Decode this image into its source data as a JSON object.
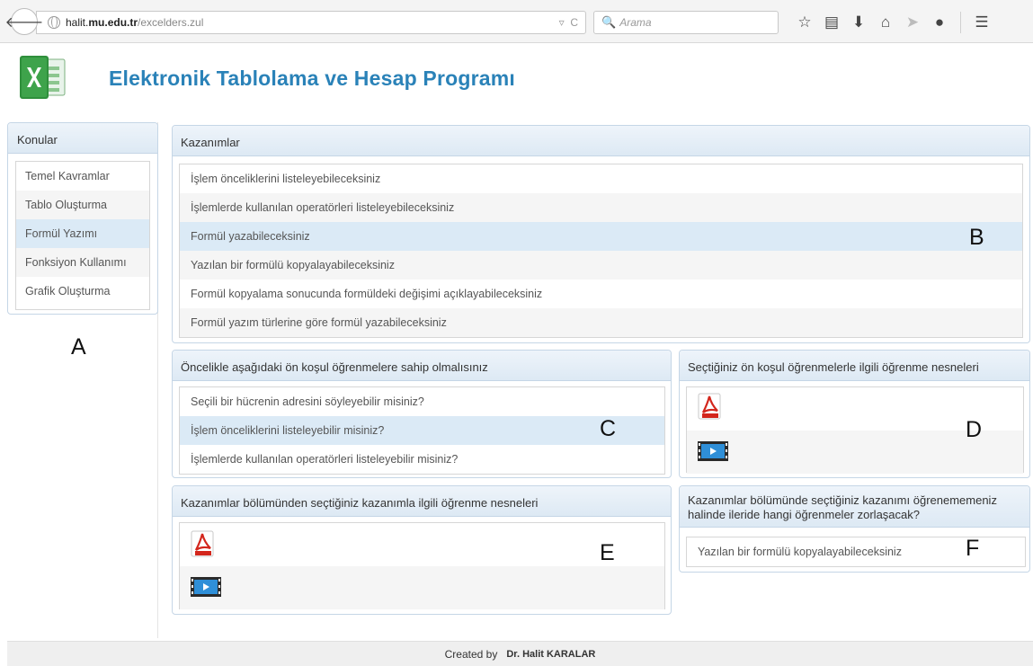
{
  "browser": {
    "url_host_prefix": "halit.",
    "url_host_domain": "mu.edu.tr",
    "url_path": "/excelders.zul",
    "search_placeholder": "Arama"
  },
  "page": {
    "title": "Elektronik Tablolama ve Hesap Programı"
  },
  "sidebar": {
    "header": "Konular",
    "items": [
      "Temel Kavramlar",
      "Tablo Oluşturma",
      "Formül Yazımı",
      "Fonksiyon Kullanımı",
      "Grafik Oluşturma"
    ],
    "selected_index": 2,
    "marker": "A"
  },
  "kazanimlar": {
    "header": "Kazanımlar",
    "items": [
      "İşlem önceliklerini listeleyebileceksiniz",
      "İşlemlerde kullanılan operatörleri listeleyebileceksiniz",
      "Formül yazabileceksiniz",
      "Yazılan bir formülü kopyalayabileceksiniz",
      "Formül kopyalama sonucunda formüldeki değişimi açıklayabileceksiniz",
      "Formül yazım türlerine göre formül yazabileceksiniz"
    ],
    "selected_index": 2,
    "marker": "B"
  },
  "prerequisites": {
    "header": "Öncelikle aşağıdaki ön koşul öğrenmelere sahip olmalısınız",
    "items": [
      "Seçili bir hücrenin adresini söyleyebilir misiniz?",
      "İşlem önceliklerini listeleyebilir misiniz?",
      "İşlemlerde kullanılan operatörleri listeleyebilir misiniz?"
    ],
    "selected_index": 1,
    "marker": "C"
  },
  "prereq_objects": {
    "header": "Seçtiğiniz ön koşul öğrenmelerle ilgili öğrenme nesneleri",
    "icons": [
      "pdf-icon",
      "video-icon"
    ],
    "marker": "D"
  },
  "learning_objects": {
    "header": "Kazanımlar bölümünden seçtiğiniz kazanımla ilgili öğrenme nesneleri",
    "icons": [
      "pdf-icon",
      "video-icon"
    ],
    "marker": "E"
  },
  "future_difficulty": {
    "header": "Kazanımlar bölümünde seçtiğiniz kazanımı öğrenememeniz halinde ileride hangi öğrenmeler zorlaşacak?",
    "items": [
      "Yazılan bir formülü kopyalayabileceksiniz"
    ],
    "marker": "F"
  },
  "footer": {
    "created_by": "Created by",
    "author": "Dr. Halit KARALAR"
  },
  "colors": {
    "title_blue": "#2a82b8",
    "selected_row": "#dbeaf6",
    "alt_row": "#f5f5f5",
    "panel_border": "#c5d6e6"
  }
}
